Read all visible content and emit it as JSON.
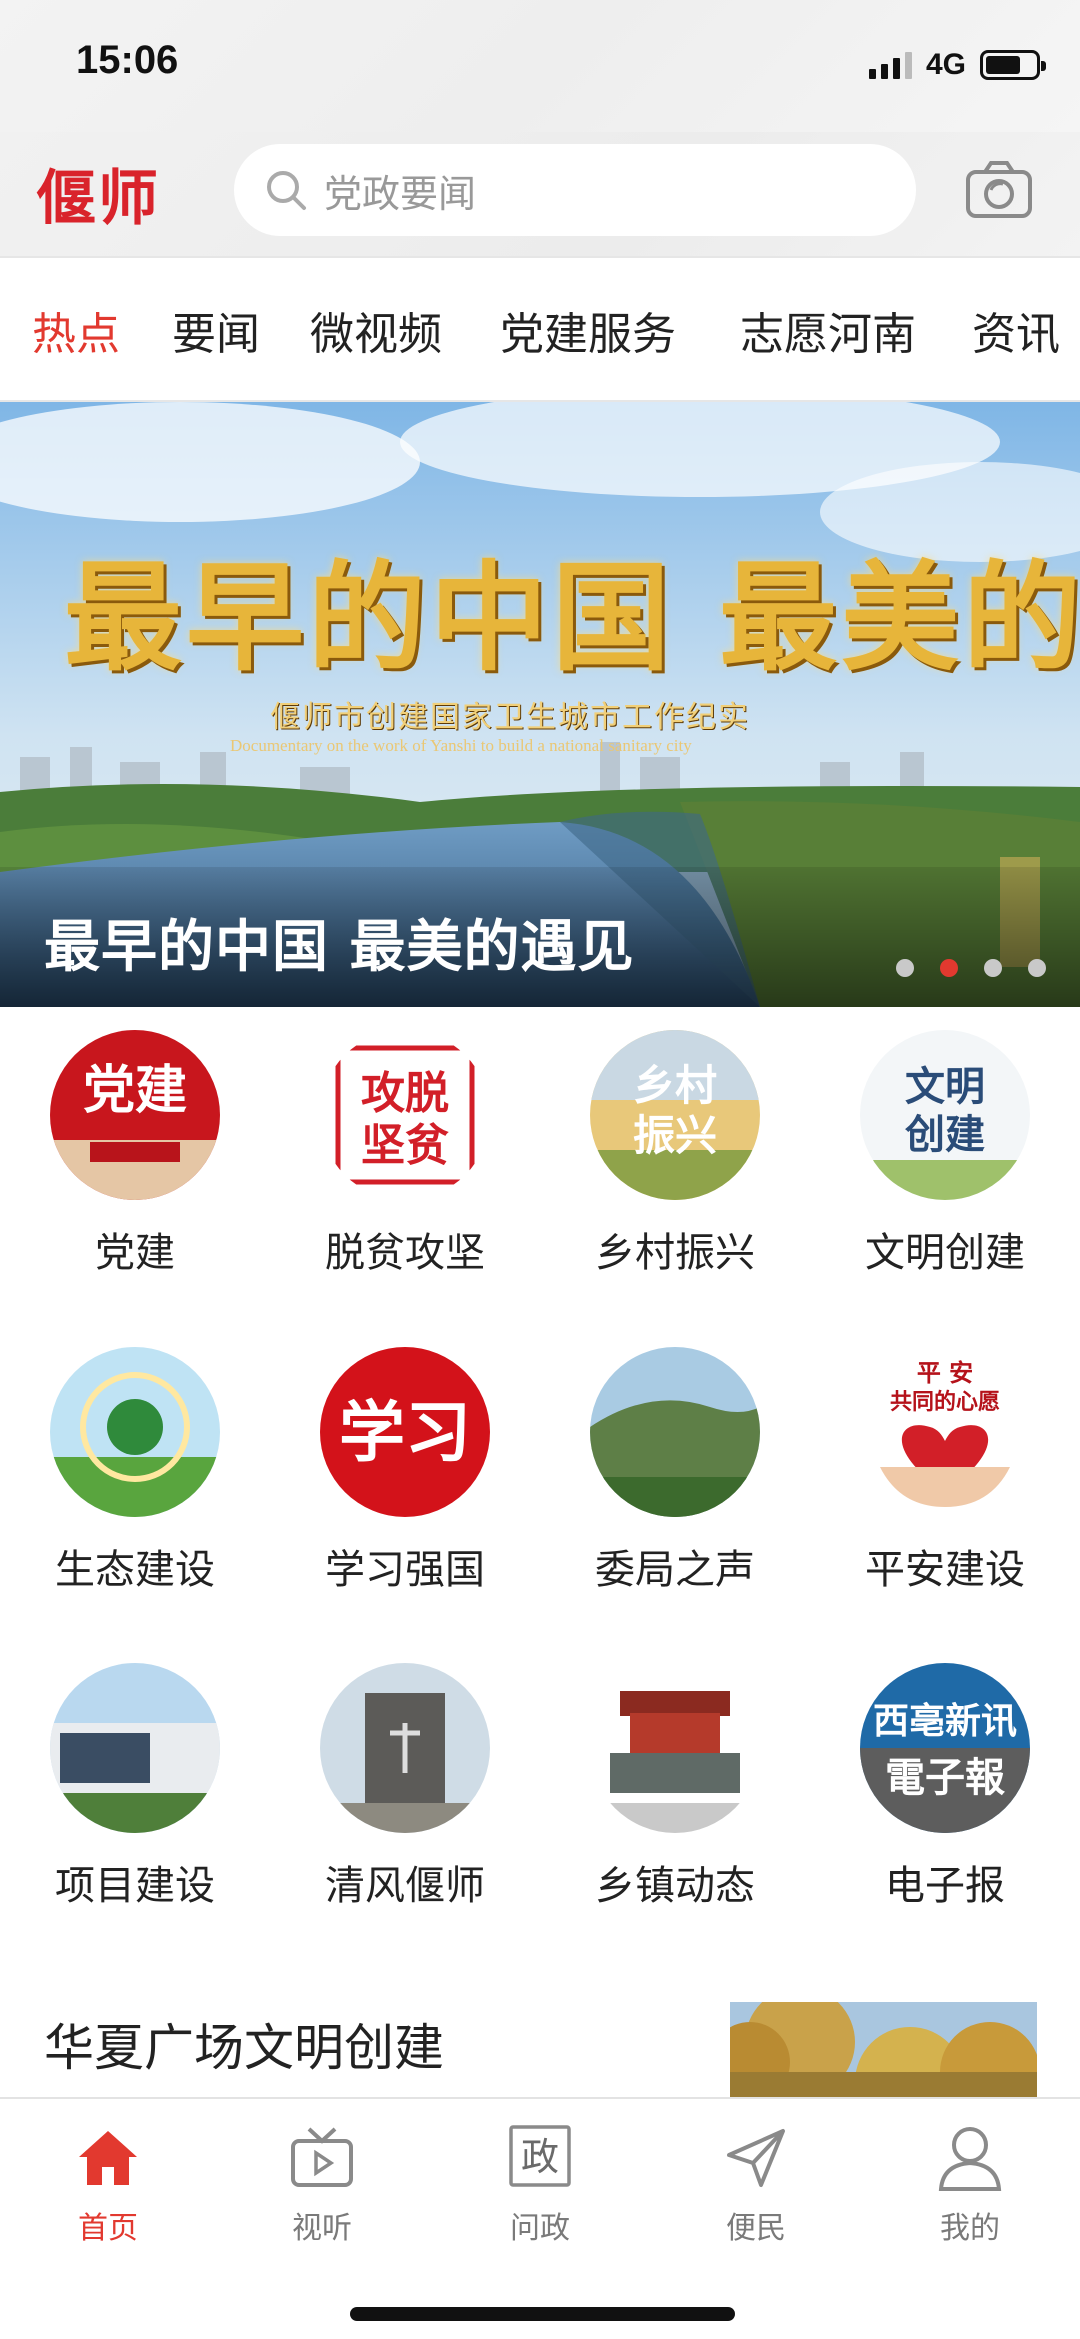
{
  "status_bar": {
    "time": "15:06",
    "network": "4G",
    "battery_level_pct": 70
  },
  "header": {
    "logo": "偃师",
    "search_placeholder": "党政要闻",
    "camera_icon": "camera-icon"
  },
  "tabs": [
    {
      "label": "热点",
      "active": true
    },
    {
      "label": "要闻",
      "active": false
    },
    {
      "label": "微视频",
      "active": false
    },
    {
      "label": "党建服务",
      "active": false
    },
    {
      "label": "志愿河南",
      "active": false
    },
    {
      "label": "资讯",
      "active": false
    }
  ],
  "banner": {
    "image_title": "最早的中国 最美的遇见",
    "image_subtitle": "偃师市创建国家卫生城市工作纪实",
    "image_subtitle_en": "Documentary on the work of Yanshi to build a national sanitary city",
    "caption": "最早的中国 最美的遇见",
    "page_count": 4,
    "active_page": 2
  },
  "grid": [
    {
      "label": "党建",
      "icon": "party-building-icon",
      "art": "党建"
    },
    {
      "label": "脱贫攻坚",
      "icon": "poverty-alleviation-icon",
      "art": "攻脱坚贫"
    },
    {
      "label": "乡村振兴",
      "icon": "rural-revitalization-icon",
      "art": "乡村振兴"
    },
    {
      "label": "文明创建",
      "icon": "civilization-icon",
      "art": "文明创建"
    },
    {
      "label": "生态建设",
      "icon": "ecology-icon",
      "art": ""
    },
    {
      "label": "学习强国",
      "icon": "study-icon",
      "art": "学习"
    },
    {
      "label": "委局之声",
      "icon": "committee-voice-icon",
      "art": ""
    },
    {
      "label": "平安建设",
      "icon": "safety-icon",
      "art": "平 安 共同的心愿"
    },
    {
      "label": "项目建设",
      "icon": "project-icon",
      "art": ""
    },
    {
      "label": "清风偃师",
      "icon": "clean-wind-icon",
      "art": ""
    },
    {
      "label": "乡镇动态",
      "icon": "town-news-icon",
      "art": ""
    },
    {
      "label": "电子报",
      "icon": "e-newspaper-icon",
      "art": "西亳新讯 電子報"
    }
  ],
  "article": {
    "title": "华夏广场文明创建"
  },
  "bottom_nav": [
    {
      "label": "首页",
      "icon": "home-icon",
      "active": true
    },
    {
      "label": "视听",
      "icon": "tv-icon",
      "active": false
    },
    {
      "label": "问政",
      "icon": "government-icon",
      "active": false,
      "glyph": "政"
    },
    {
      "label": "便民",
      "icon": "send-icon",
      "active": false
    },
    {
      "label": "我的",
      "icon": "user-icon",
      "active": false
    }
  ],
  "colors": {
    "accent": "#e2392f",
    "logo": "#d9232b",
    "text": "#222222",
    "muted": "#7a7a7a"
  }
}
